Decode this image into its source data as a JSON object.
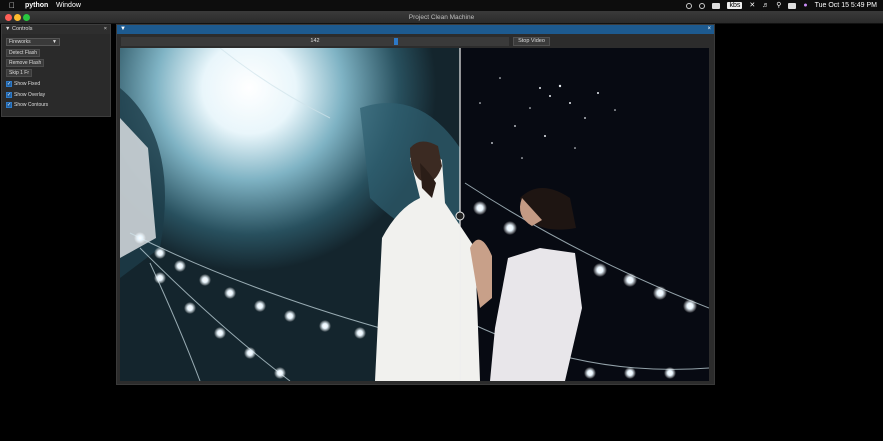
{
  "menubar": {
    "app_name": "python",
    "menu_window": "Window",
    "clock": "Tue Oct 15  5:49 PM",
    "badge": "kbs"
  },
  "window": {
    "title": "Project Clean Machine"
  },
  "controls_panel": {
    "title": "Controls",
    "close": "×",
    "mode_select": {
      "value": "Fireworks"
    },
    "buttons": [
      "Detect Flash",
      "Remove Flash",
      "Skip 1 Fr"
    ],
    "checkboxes": [
      {
        "label": "Show Fixed",
        "checked": true
      },
      {
        "label": "Show Overlay",
        "checked": true
      },
      {
        "label": "Show Contours",
        "checked": true
      }
    ]
  },
  "video_panel": {
    "collapse": "▼",
    "close": "×",
    "frame_slider": {
      "value": "142",
      "position": 0.71
    },
    "stop_label": "Stop Video"
  },
  "colors": {
    "accent": "#2d79c7",
    "header_blue": "#1d5a8f",
    "panel_bg": "#2a2a2a"
  }
}
